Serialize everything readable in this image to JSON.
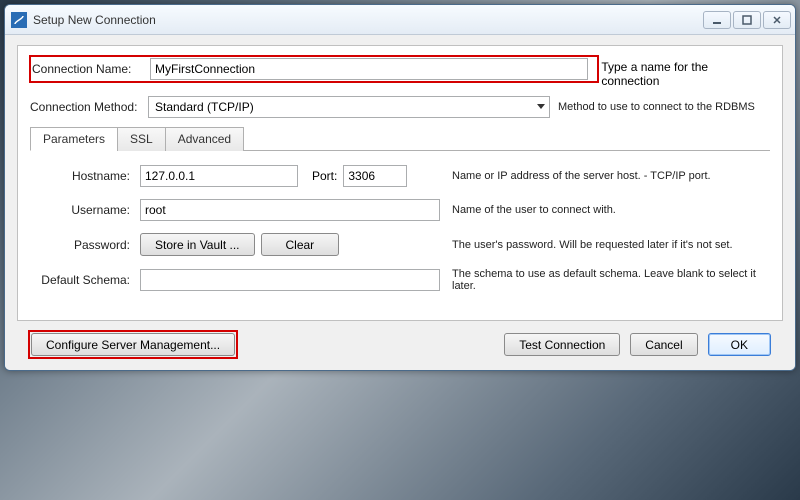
{
  "window": {
    "title": "Setup New Connection"
  },
  "top": {
    "conn_name_label": "Connection Name:",
    "conn_name_value": "MyFirstConnection",
    "conn_name_descr": "Type a name for the connection",
    "conn_method_label": "Connection Method:",
    "conn_method_value": "Standard (TCP/IP)",
    "conn_method_descr": "Method to use to connect to the RDBMS"
  },
  "tabs": {
    "parameters": "Parameters",
    "ssl": "SSL",
    "advanced": "Advanced"
  },
  "fields": {
    "hostname_label": "Hostname:",
    "hostname_value": "127.0.0.1",
    "port_label": "Port:",
    "port_value": "3306",
    "hostport_descr": "Name or IP address of the server host. - TCP/IP port.",
    "username_label": "Username:",
    "username_value": "root",
    "username_descr": "Name of the user to connect with.",
    "password_label": "Password:",
    "store_btn": "Store in Vault ...",
    "clear_btn": "Clear",
    "password_descr": "The user's password. Will be requested later if it's not set.",
    "defschema_label": "Default Schema:",
    "defschema_value": "",
    "defschema_descr": "The schema to use as default schema. Leave blank to select it later."
  },
  "buttons": {
    "configure": "Configure Server Management...",
    "test": "Test Connection",
    "cancel": "Cancel",
    "ok": "OK"
  }
}
